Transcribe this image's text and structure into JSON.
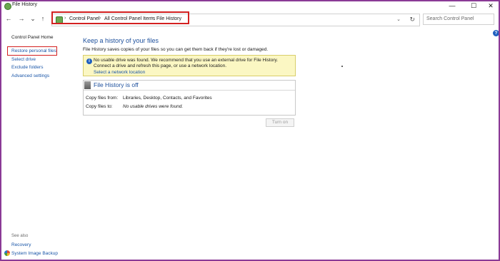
{
  "window": {
    "title": "File History",
    "controls": {
      "minimize": "—",
      "maximize": "☐",
      "close": "✕"
    }
  },
  "nav": {
    "back": "←",
    "forward": "→",
    "recent": "⌄",
    "up": "↑",
    "address_sep": "›",
    "breadcrumbs": [
      "Control Panel",
      "All Control Panel Items",
      "File History"
    ],
    "dropdown": "⌄",
    "refresh": "↻"
  },
  "search": {
    "placeholder": "Search Control Panel"
  },
  "sidebar": {
    "home": "Control Panel Home",
    "items": [
      "Restore personal files",
      "Select drive",
      "Exclude folders",
      "Advanced settings"
    ],
    "see_also_label": "See also",
    "see_also": [
      "Recovery",
      "System Image Backup"
    ]
  },
  "main": {
    "heading": "Keep a history of your files",
    "subtext": "File History saves copies of your files so you can get them back if they're lost or damaged.",
    "warning": {
      "icon": "i",
      "text": "No usable drive was found. We recommend that you use an external drive for File History. Connect a drive and refresh this page, or use a network location.",
      "link": "Select a network location"
    },
    "status": {
      "title": "File History is off",
      "copy_from_label": "Copy files from:",
      "copy_from_value": "Libraries, Desktop, Contacts, and Favorites",
      "copy_to_label": "Copy files to:",
      "copy_to_value": "No usable drives were found."
    },
    "turn_on": "Turn on",
    "help": "?"
  },
  "colors": {
    "frame": "#8a3a96",
    "highlight": "#d32020",
    "heading": "#1c4f9c",
    "link": "#1a56a8",
    "warning_bg": "#fbf7c3"
  }
}
